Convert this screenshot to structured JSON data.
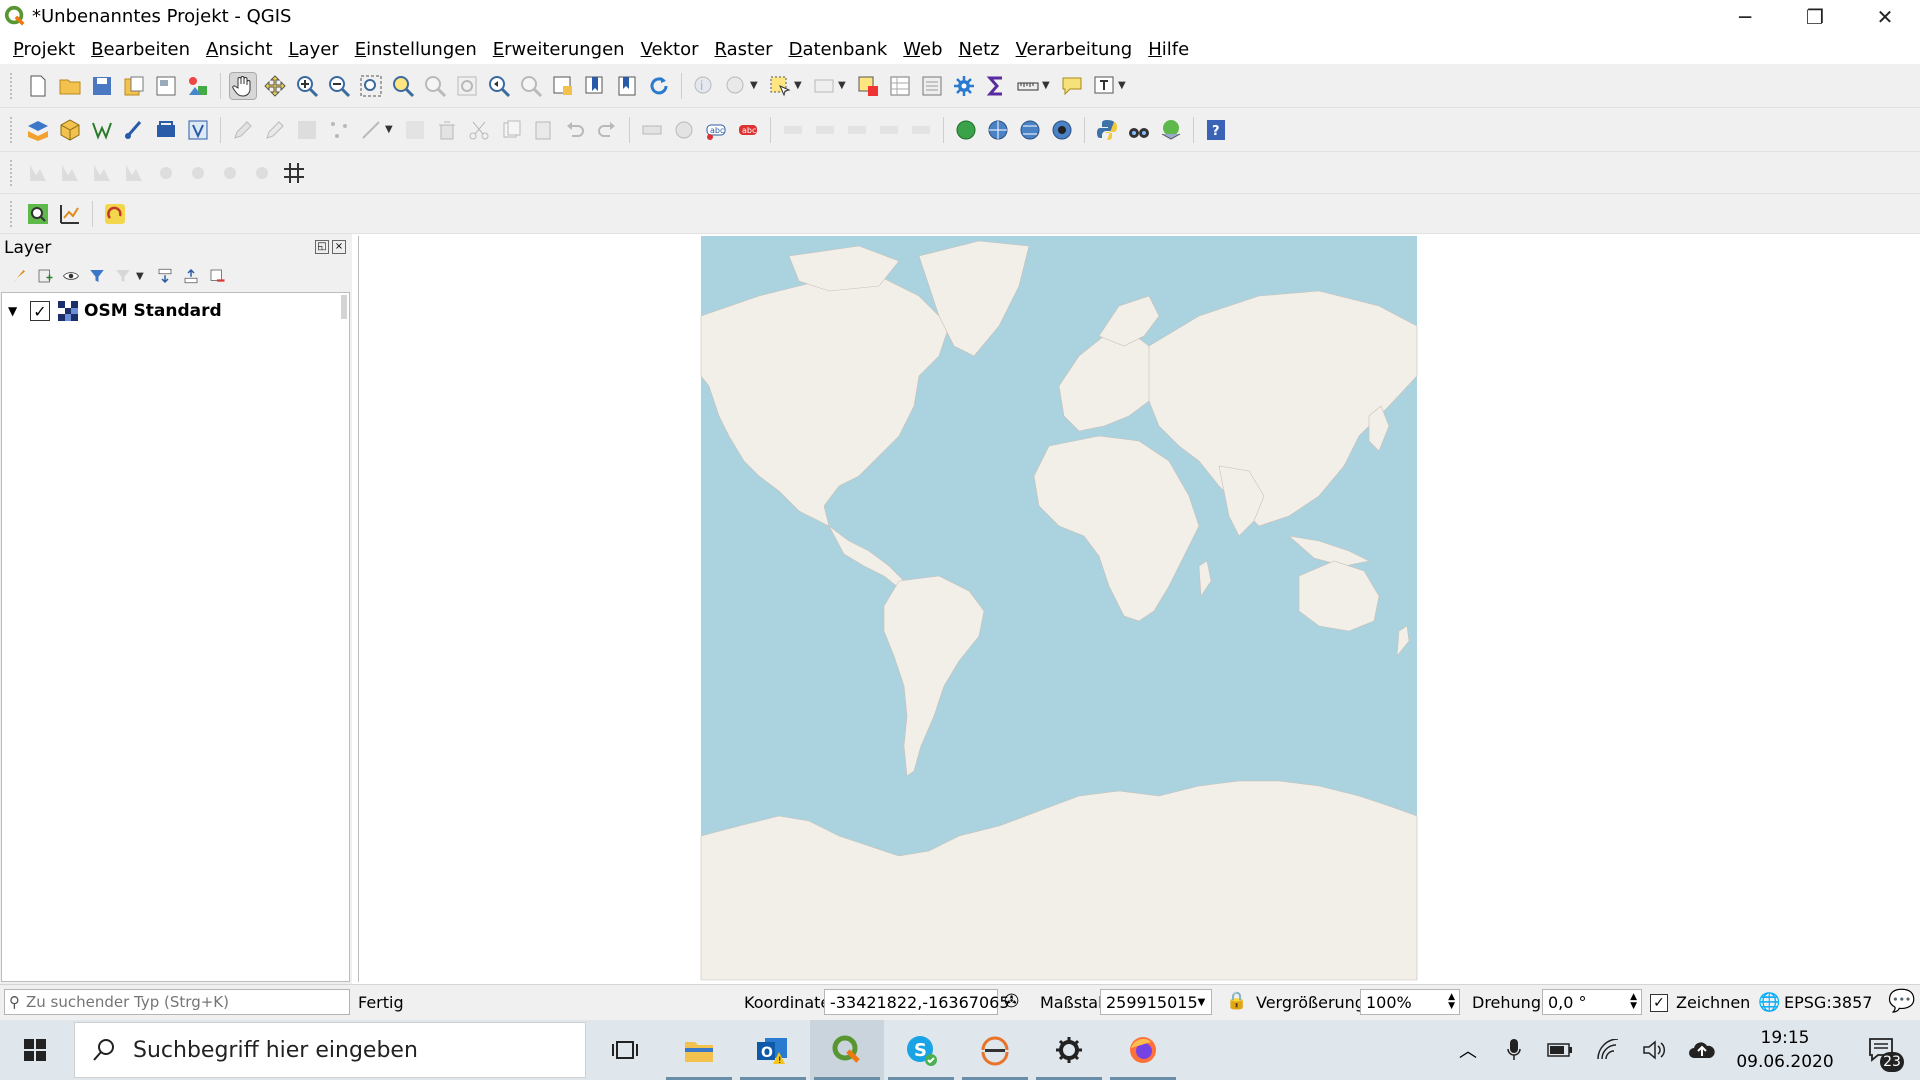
{
  "window": {
    "title": "*Unbenanntes Projekt - QGIS",
    "controls": [
      "minimize",
      "restore",
      "close"
    ]
  },
  "menubar": {
    "items": [
      "Projekt",
      "Bearbeiten",
      "Ansicht",
      "Layer",
      "Einstellungen",
      "Erweiterungen",
      "Vektor",
      "Raster",
      "Datenbank",
      "Web",
      "Netz",
      "Verarbeitung",
      "Hilfe"
    ]
  },
  "layers_panel": {
    "title": "Layer",
    "layers": [
      {
        "name": "OSM Standard",
        "checked": true,
        "expanded": true
      }
    ]
  },
  "map": {
    "layer": "OSM Standard",
    "water_color": "#aad3df",
    "land_color": "#f2efe9"
  },
  "statusbar": {
    "search_placeholder": "Zu suchender Typ (Strg+K)",
    "message": "Fertig",
    "coordinate_label": "Koordinate",
    "coordinate_value": "-33421822,-16367065",
    "scale_label": "Maßstab",
    "scale_value": "259915015",
    "magnifier_label": "Vergrößerung",
    "magnifier_value": "100%",
    "rotation_label": "Drehung",
    "rotation_value": "0,0 °",
    "render_label": "Zeichnen",
    "render_checked": true,
    "crs": "EPSG:3857"
  },
  "taskbar": {
    "search_placeholder": "Suchbegriff hier eingeben",
    "clock_time": "19:15",
    "clock_date": "09.06.2020",
    "notification_count": "23"
  },
  "colors": {
    "accent_qgis": "#589632",
    "toolbar_bg": "#f0f0f0",
    "taskbar_bg": "#dfe6ec"
  }
}
